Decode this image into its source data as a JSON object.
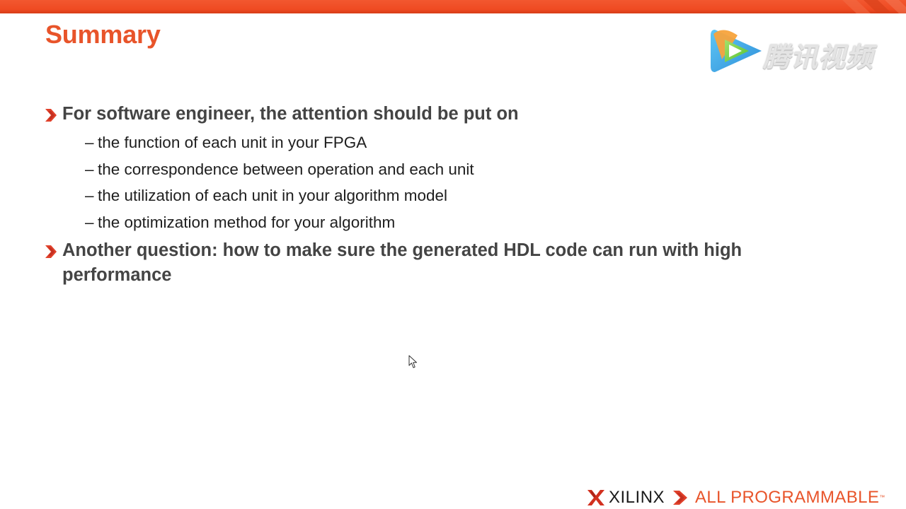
{
  "slide": {
    "title": "Summary",
    "bullets": [
      {
        "text": "For software engineer, the attention should be put on",
        "sub_items": [
          {
            "dash": "–",
            "text": "the function of each unit in your FPGA"
          },
          {
            "dash": "–",
            "text": "the correspondence between operation and each unit"
          },
          {
            "dash": "–",
            "text": "the utilization of each unit in your algorithm model"
          },
          {
            "dash": "–",
            "text": "the optimization method for your algorithm"
          }
        ]
      },
      {
        "text": "Another question: how to make sure the generated HDL code can run with high performance",
        "sub_items": []
      }
    ]
  },
  "watermark": {
    "text": "腾讯视频",
    "icon": "play-icon"
  },
  "footer": {
    "brand": "XILINX",
    "tagline": "ALL PROGRAMMABLE",
    "tm": "™"
  },
  "colors": {
    "accent": "#e8542a",
    "top_bar": "#ef4a22",
    "body_text": "#444444",
    "sub_text": "#1e1e1e"
  }
}
